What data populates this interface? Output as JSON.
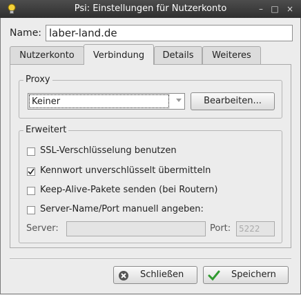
{
  "window": {
    "title": "Psi: Einstellungen für Nutzerkonto",
    "min_glyph": "–",
    "max_glyph": "□",
    "close_glyph": "×"
  },
  "name_label": "Name:",
  "name_value": "laber-land.de",
  "tabs": [
    {
      "label": "Nutzerkonto"
    },
    {
      "label": "Verbindung"
    },
    {
      "label": "Details"
    },
    {
      "label": "Weiteres"
    }
  ],
  "proxy": {
    "group_title": "Proxy",
    "selected": "Keiner",
    "edit_button": "Bearbeiten..."
  },
  "advanced": {
    "group_title": "Erweitert",
    "options": [
      {
        "label": "SSL-Verschlüsselung benutzen",
        "checked": false
      },
      {
        "label": "Kennwort unverschlüsselt übermitteln",
        "checked": true
      },
      {
        "label": "Keep-Alive-Pakete senden (bei Routern)",
        "checked": false
      },
      {
        "label": "Server-Name/Port manuell angeben:",
        "checked": false
      }
    ],
    "server_label": "Server:",
    "server_value": "",
    "port_label": "Port:",
    "port_placeholder": "5222"
  },
  "buttons": {
    "close_label": "Schließen",
    "save_label": "Speichern"
  },
  "icons": {
    "app": "lightbulb-icon",
    "close": "close-circle-icon",
    "save": "checkmark-icon"
  }
}
